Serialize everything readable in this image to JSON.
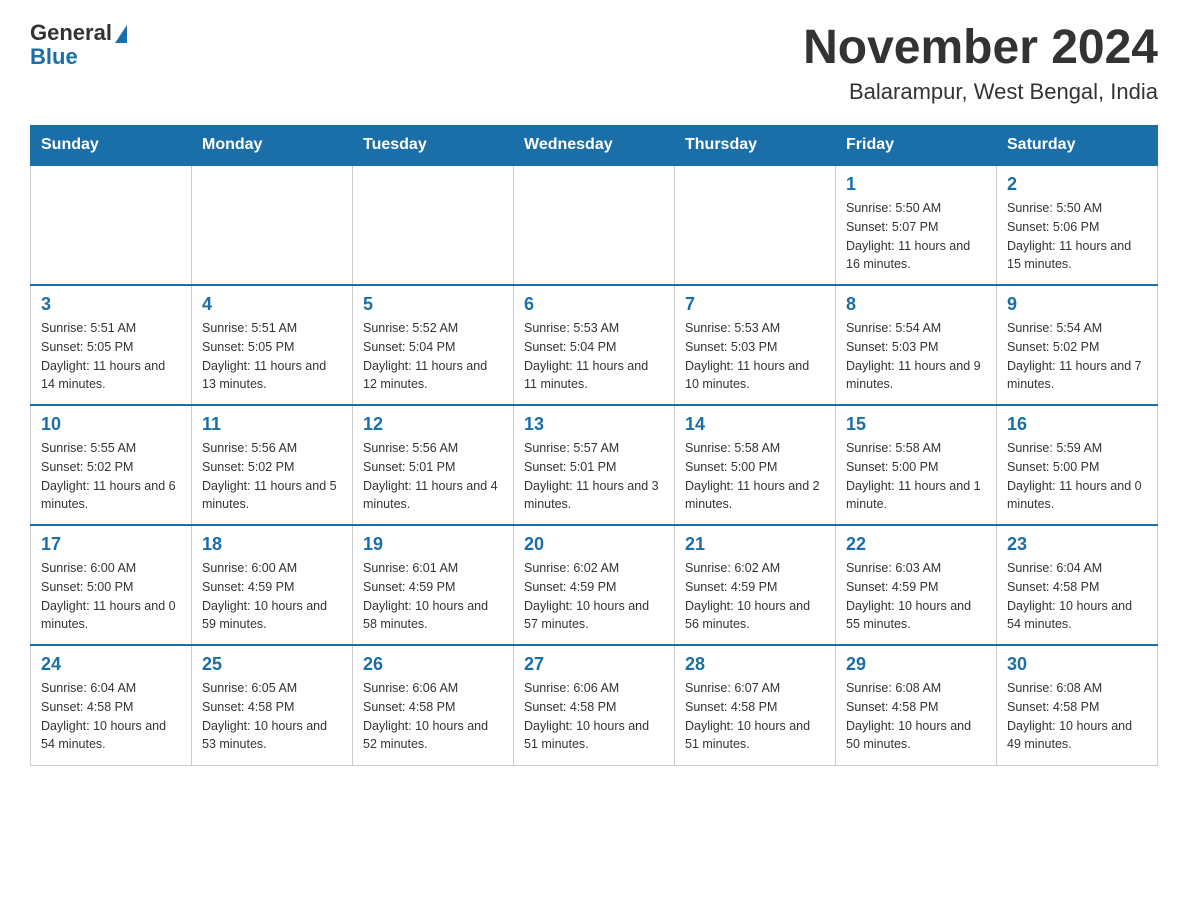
{
  "logo": {
    "general": "General",
    "blue": "Blue"
  },
  "title": "November 2024",
  "subtitle": "Balarampur, West Bengal, India",
  "headers": [
    "Sunday",
    "Monday",
    "Tuesday",
    "Wednesday",
    "Thursday",
    "Friday",
    "Saturday"
  ],
  "weeks": [
    [
      {
        "day": "",
        "sunrise": "",
        "sunset": "",
        "daylight": ""
      },
      {
        "day": "",
        "sunrise": "",
        "sunset": "",
        "daylight": ""
      },
      {
        "day": "",
        "sunrise": "",
        "sunset": "",
        "daylight": ""
      },
      {
        "day": "",
        "sunrise": "",
        "sunset": "",
        "daylight": ""
      },
      {
        "day": "",
        "sunrise": "",
        "sunset": "",
        "daylight": ""
      },
      {
        "day": "1",
        "sunrise": "Sunrise: 5:50 AM",
        "sunset": "Sunset: 5:07 PM",
        "daylight": "Daylight: 11 hours and 16 minutes."
      },
      {
        "day": "2",
        "sunrise": "Sunrise: 5:50 AM",
        "sunset": "Sunset: 5:06 PM",
        "daylight": "Daylight: 11 hours and 15 minutes."
      }
    ],
    [
      {
        "day": "3",
        "sunrise": "Sunrise: 5:51 AM",
        "sunset": "Sunset: 5:05 PM",
        "daylight": "Daylight: 11 hours and 14 minutes."
      },
      {
        "day": "4",
        "sunrise": "Sunrise: 5:51 AM",
        "sunset": "Sunset: 5:05 PM",
        "daylight": "Daylight: 11 hours and 13 minutes."
      },
      {
        "day": "5",
        "sunrise": "Sunrise: 5:52 AM",
        "sunset": "Sunset: 5:04 PM",
        "daylight": "Daylight: 11 hours and 12 minutes."
      },
      {
        "day": "6",
        "sunrise": "Sunrise: 5:53 AM",
        "sunset": "Sunset: 5:04 PM",
        "daylight": "Daylight: 11 hours and 11 minutes."
      },
      {
        "day": "7",
        "sunrise": "Sunrise: 5:53 AM",
        "sunset": "Sunset: 5:03 PM",
        "daylight": "Daylight: 11 hours and 10 minutes."
      },
      {
        "day": "8",
        "sunrise": "Sunrise: 5:54 AM",
        "sunset": "Sunset: 5:03 PM",
        "daylight": "Daylight: 11 hours and 9 minutes."
      },
      {
        "day": "9",
        "sunrise": "Sunrise: 5:54 AM",
        "sunset": "Sunset: 5:02 PM",
        "daylight": "Daylight: 11 hours and 7 minutes."
      }
    ],
    [
      {
        "day": "10",
        "sunrise": "Sunrise: 5:55 AM",
        "sunset": "Sunset: 5:02 PM",
        "daylight": "Daylight: 11 hours and 6 minutes."
      },
      {
        "day": "11",
        "sunrise": "Sunrise: 5:56 AM",
        "sunset": "Sunset: 5:02 PM",
        "daylight": "Daylight: 11 hours and 5 minutes."
      },
      {
        "day": "12",
        "sunrise": "Sunrise: 5:56 AM",
        "sunset": "Sunset: 5:01 PM",
        "daylight": "Daylight: 11 hours and 4 minutes."
      },
      {
        "day": "13",
        "sunrise": "Sunrise: 5:57 AM",
        "sunset": "Sunset: 5:01 PM",
        "daylight": "Daylight: 11 hours and 3 minutes."
      },
      {
        "day": "14",
        "sunrise": "Sunrise: 5:58 AM",
        "sunset": "Sunset: 5:00 PM",
        "daylight": "Daylight: 11 hours and 2 minutes."
      },
      {
        "day": "15",
        "sunrise": "Sunrise: 5:58 AM",
        "sunset": "Sunset: 5:00 PM",
        "daylight": "Daylight: 11 hours and 1 minute."
      },
      {
        "day": "16",
        "sunrise": "Sunrise: 5:59 AM",
        "sunset": "Sunset: 5:00 PM",
        "daylight": "Daylight: 11 hours and 0 minutes."
      }
    ],
    [
      {
        "day": "17",
        "sunrise": "Sunrise: 6:00 AM",
        "sunset": "Sunset: 5:00 PM",
        "daylight": "Daylight: 11 hours and 0 minutes."
      },
      {
        "day": "18",
        "sunrise": "Sunrise: 6:00 AM",
        "sunset": "Sunset: 4:59 PM",
        "daylight": "Daylight: 10 hours and 59 minutes."
      },
      {
        "day": "19",
        "sunrise": "Sunrise: 6:01 AM",
        "sunset": "Sunset: 4:59 PM",
        "daylight": "Daylight: 10 hours and 58 minutes."
      },
      {
        "day": "20",
        "sunrise": "Sunrise: 6:02 AM",
        "sunset": "Sunset: 4:59 PM",
        "daylight": "Daylight: 10 hours and 57 minutes."
      },
      {
        "day": "21",
        "sunrise": "Sunrise: 6:02 AM",
        "sunset": "Sunset: 4:59 PM",
        "daylight": "Daylight: 10 hours and 56 minutes."
      },
      {
        "day": "22",
        "sunrise": "Sunrise: 6:03 AM",
        "sunset": "Sunset: 4:59 PM",
        "daylight": "Daylight: 10 hours and 55 minutes."
      },
      {
        "day": "23",
        "sunrise": "Sunrise: 6:04 AM",
        "sunset": "Sunset: 4:58 PM",
        "daylight": "Daylight: 10 hours and 54 minutes."
      }
    ],
    [
      {
        "day": "24",
        "sunrise": "Sunrise: 6:04 AM",
        "sunset": "Sunset: 4:58 PM",
        "daylight": "Daylight: 10 hours and 54 minutes."
      },
      {
        "day": "25",
        "sunrise": "Sunrise: 6:05 AM",
        "sunset": "Sunset: 4:58 PM",
        "daylight": "Daylight: 10 hours and 53 minutes."
      },
      {
        "day": "26",
        "sunrise": "Sunrise: 6:06 AM",
        "sunset": "Sunset: 4:58 PM",
        "daylight": "Daylight: 10 hours and 52 minutes."
      },
      {
        "day": "27",
        "sunrise": "Sunrise: 6:06 AM",
        "sunset": "Sunset: 4:58 PM",
        "daylight": "Daylight: 10 hours and 51 minutes."
      },
      {
        "day": "28",
        "sunrise": "Sunrise: 6:07 AM",
        "sunset": "Sunset: 4:58 PM",
        "daylight": "Daylight: 10 hours and 51 minutes."
      },
      {
        "day": "29",
        "sunrise": "Sunrise: 6:08 AM",
        "sunset": "Sunset: 4:58 PM",
        "daylight": "Daylight: 10 hours and 50 minutes."
      },
      {
        "day": "30",
        "sunrise": "Sunrise: 6:08 AM",
        "sunset": "Sunset: 4:58 PM",
        "daylight": "Daylight: 10 hours and 49 minutes."
      }
    ]
  ]
}
